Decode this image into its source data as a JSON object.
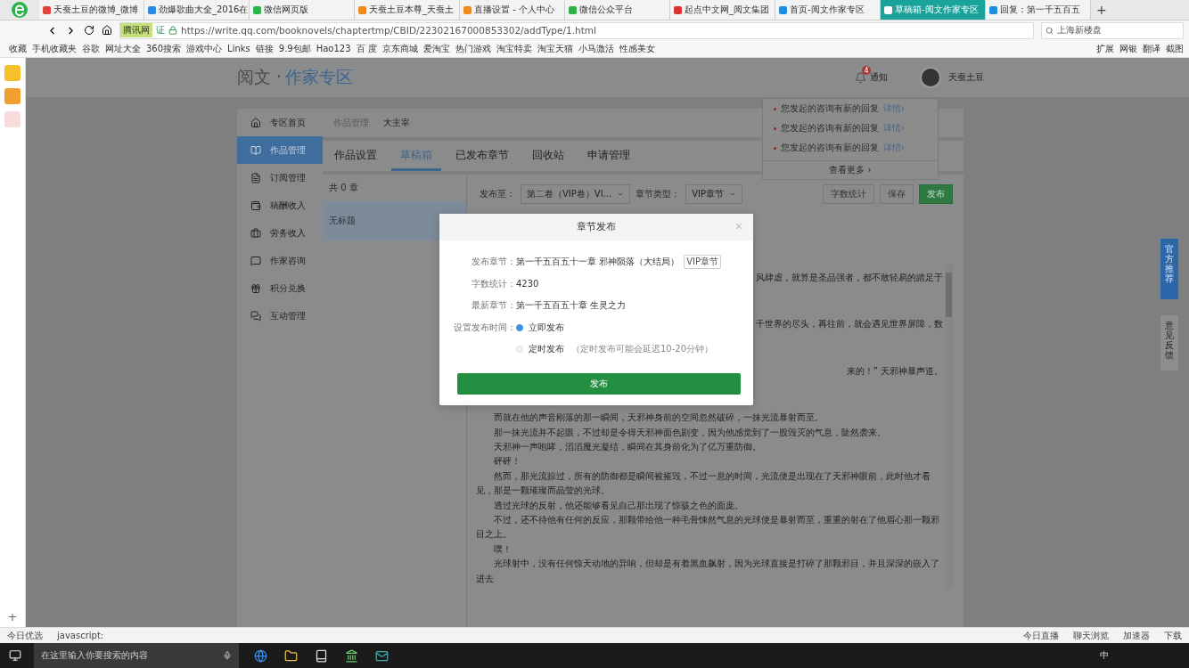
{
  "browser": {
    "tabs": [
      {
        "label": "天蚕土豆的微博_微博",
        "selected": false
      },
      {
        "label": "劲爆歌曲大全_2016在",
        "selected": false
      },
      {
        "label": "微信网页版",
        "selected": false
      },
      {
        "label": "天蚕土豆本尊_天蚕土",
        "selected": false
      },
      {
        "label": "直播设置 - 个人中心",
        "selected": false
      },
      {
        "label": "微信公众平台",
        "selected": false
      },
      {
        "label": "起点中文网_阅文集团",
        "selected": false
      },
      {
        "label": "首页-阅文作家专区",
        "selected": false
      },
      {
        "label": "草稿箱-阅文作家专区",
        "selected": true
      },
      {
        "label": "回复：第一千五百五",
        "selected": false
      }
    ],
    "new_tab": "+",
    "site_badge": "腾讯网",
    "cert": "证",
    "url": "https://write.qq.com/booknovels/chaptertmp/CBID/22302167000853302/addType/1.html",
    "search": "上海新楼盘",
    "bookmarks": [
      "收藏",
      "手机收藏夹",
      "谷歌",
      "网址大全",
      "360搜索",
      "游戏中心",
      "Links",
      "链接",
      "9.9包邮",
      "Hao123",
      "百 度",
      "京东商城",
      "爱淘宝",
      "热门游戏",
      "淘宝特卖",
      "淘宝天猫",
      "小马激活",
      "性感美女"
    ],
    "bookmark_tools": [
      "扩展",
      "网银",
      "翻译",
      "截图"
    ]
  },
  "side_strip": {
    "add": "+"
  },
  "header": {
    "logo_prefix": "阅文 ·",
    "logo_main": "作家专区",
    "notify_label": "通知",
    "notify_count": "4",
    "user": "天蚕土豆"
  },
  "notifications": {
    "items": [
      {
        "text": "您发起的咨询有新的回复",
        "link": "详情›"
      },
      {
        "text": "您发起的咨询有新的回复",
        "link": "详情›"
      },
      {
        "text": "您发起的咨询有新的回复",
        "link": "详情›"
      }
    ],
    "more": "查看更多 ›"
  },
  "sidebar": [
    {
      "label": "专区首页",
      "selected": false
    },
    {
      "label": "作品管理",
      "selected": true
    },
    {
      "label": "订阅管理",
      "selected": false
    },
    {
      "label": "稿酬收入",
      "selected": false
    },
    {
      "label": "劳务收入",
      "selected": false
    },
    {
      "label": "作家咨询",
      "selected": false
    },
    {
      "label": "积分兑换",
      "selected": false
    },
    {
      "label": "互动管理",
      "selected": false
    }
  ],
  "breadcrumb": [
    "作品管理",
    "大主宰"
  ],
  "tabs": [
    {
      "label": "作品设置",
      "selected": false
    },
    {
      "label": "草稿箱",
      "selected": true
    },
    {
      "label": "已发布章节",
      "selected": false
    },
    {
      "label": "回收站",
      "selected": false
    },
    {
      "label": "申请管理",
      "selected": false
    }
  ],
  "chapter_list": {
    "count": "共 0 章",
    "items": [
      {
        "title": "无标题",
        "selected": true
      }
    ]
  },
  "toolbar": {
    "publish_to_label": "发布至：",
    "publish_to": "第二卷（VIP卷）VI...",
    "type_label": "章节类型：",
    "type": "VIP章节",
    "buttons": [
      "字数统计",
      "保存",
      "发布"
    ]
  },
  "editor": [
    {
      "kind": "partial",
      "text": "风肆虐，就算是圣品强者，都不敢轻易的踏足于"
    },
    {
      "kind": "partial",
      "text": "千世界的尽头，再往前，就会遇见世界屏障，数"
    },
    {
      "kind": "partial",
      "text": "来的！” 天邪神暴声道。"
    },
    {
      "kind": "para",
      "text": "而就在他的声音刚落的那一瞬间，天邪神身前的空间忽然破碎，一抹光流暴射而至。"
    },
    {
      "kind": "para",
      "text": "那一抹光流并不起眼，不过却是令得天邪神面色剧变，因为他感觉到了一股毁灭的气息，陡然袭来。"
    },
    {
      "kind": "para",
      "text": "天邪神一声咆哮，滔滔魔光凝结，瞬间在其身前化为了亿万重防御。"
    },
    {
      "kind": "para",
      "text": "砰砰！"
    },
    {
      "kind": "para",
      "text": "然而，那光流掠过，所有的防御都是瞬间被摧毁，不过一息的时间，光流便是出现在了天邪神眼前，此时他才看见，那是一颗璀璨而晶莹的光球。"
    },
    {
      "kind": "para",
      "text": "透过光球的反射，他还能够看见自己那出现了惊骇之色的面庞。"
    },
    {
      "kind": "para",
      "text": "不过，还不待他有任何的反应，那颗带给他一种毛骨悚然气息的光球便是暴射而至，重重的射在了他眉心那一颗邪目之上。"
    },
    {
      "kind": "para",
      "text": "噗！"
    },
    {
      "kind": "para",
      "text": "光球射中，没有任何惊天动地的异响，但却是有着黑血飙射，因为光球直接是打碎了那颗邪目，并且深深的嵌入了进去"
    }
  ],
  "float_tabs": [
    {
      "label": "官方推荐",
      "kind": "primary"
    },
    {
      "label": "意见反馈",
      "kind": "plain"
    }
  ],
  "dialog": {
    "title": "章节发布",
    "close": "×",
    "rows": [
      {
        "label": "发布章节：",
        "value": "第一千五百五十一章 邪神陨落（大结局）",
        "tag": "VIP章节"
      },
      {
        "label": "字数统计：",
        "value": "4230"
      },
      {
        "label": "最新章节：",
        "value": "第一千五百五十章 生灵之力"
      }
    ],
    "time_label": "设置发布时间：",
    "options": [
      {
        "label": "立即发布",
        "selected": true
      },
      {
        "label": "定时发布",
        "note": "（定时发布可能会延迟10-20分钟）",
        "selected": false
      }
    ],
    "submit": "发布"
  },
  "status_bar": {
    "left": [
      "今日优选",
      "javascript:"
    ],
    "right": [
      "今日直播",
      "聊天浏览",
      "加速器",
      "下载"
    ]
  },
  "taskbar": {
    "search": "在这里输入你要搜索的内容",
    "ime": "中"
  }
}
